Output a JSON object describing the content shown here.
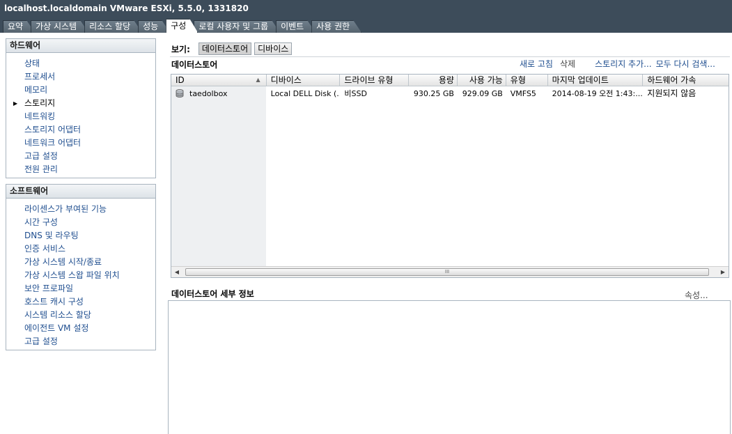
{
  "window": {
    "title": "localhost.localdomain VMware ESXi, 5.5.0, 1331820"
  },
  "tabs": [
    {
      "label": "요약",
      "active": false
    },
    {
      "label": "가상 시스템",
      "active": false
    },
    {
      "label": "리소스 할당",
      "active": false
    },
    {
      "label": "성능",
      "active": false
    },
    {
      "label": "구성",
      "active": true
    },
    {
      "label": "로컬 사용자 및 그룹",
      "active": false
    },
    {
      "label": "이벤트",
      "active": false
    },
    {
      "label": "사용 권한",
      "active": false
    }
  ],
  "hardware": {
    "title": "하드웨어",
    "items": [
      "상태",
      "프로세서",
      "메모리",
      "스토리지",
      "네트워킹",
      "스토리지 어댑터",
      "네트워크 어댑터",
      "고급 설정",
      "전원 관리"
    ],
    "selected": "스토리지"
  },
  "software": {
    "title": "소프트웨어",
    "items": [
      "라이센스가 부여된 기능",
      "시간 구성",
      "DNS 및 라우팅",
      "인증 서비스",
      "가상 시스템 시작/종료",
      "가상 시스템 스왑 파일 위치",
      "보안 프로파일",
      "호스트 캐시 구성",
      "시스템 리소스 할당",
      "에이전트 VM 설정",
      "고급 설정"
    ]
  },
  "view": {
    "label": "보기:",
    "datastores_button": "데이터스토어",
    "devices_button": "디바이스"
  },
  "datastores": {
    "title": "데이터스토어",
    "actions": {
      "refresh": "새로 고침",
      "delete": "삭제",
      "add_storage": "스토리지 추가...",
      "rescan_all": "모두 다시 검색..."
    },
    "columns": [
      "ID",
      "디바이스",
      "드라이브 유형",
      "용량",
      "사용 가능",
      "유형",
      "마지막 업데이트",
      "하드웨어 가속"
    ],
    "rows": [
      {
        "id": "taedolbox",
        "device": "Local DELL Disk (...",
        "drive_type": "비SSD",
        "capacity": "930.25 GB",
        "free": "929.09 GB",
        "type": "VMFS5",
        "last_update": "2014-08-19 오전 1:43:...",
        "hw_accel": "지원되지 않음"
      }
    ],
    "scroll_grip": "III"
  },
  "details": {
    "title": "데이터스토어 세부 정보",
    "properties_link": "속성..."
  }
}
